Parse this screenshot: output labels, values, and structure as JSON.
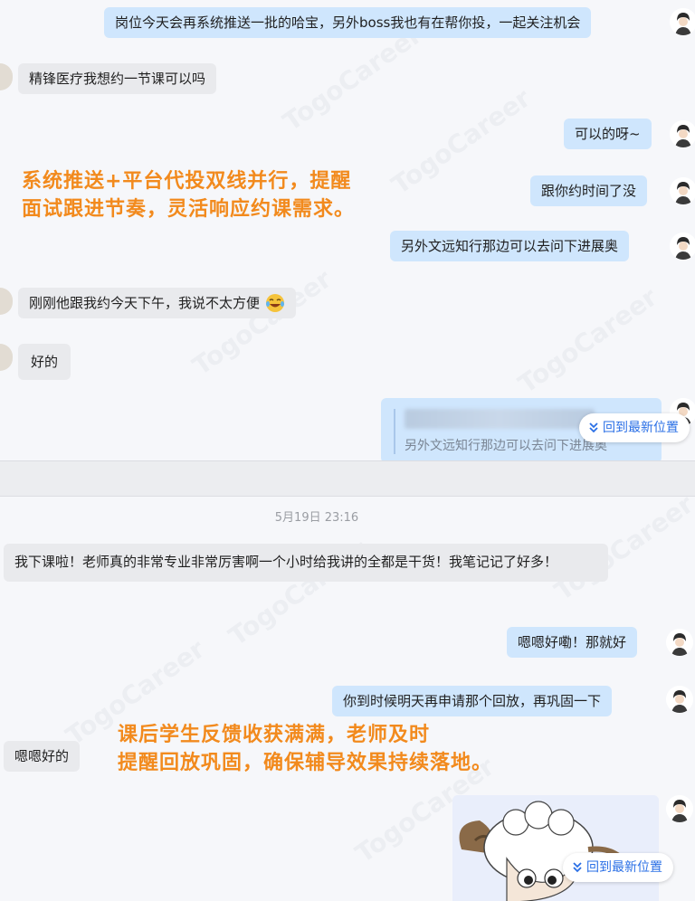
{
  "top_chat": {
    "messages": [
      {
        "side": "out",
        "text": "岗位今天会再系统推送一批的哈宝，另外boss我也有在帮你投，一起关注机会"
      },
      {
        "side": "in",
        "text": "精锋医疗我想约一节课可以吗"
      },
      {
        "side": "out",
        "text": "可以的呀~"
      },
      {
        "side": "out",
        "text": "跟你约时间了没"
      },
      {
        "side": "out",
        "text": "另外文远知行那边可以去问下进展奥"
      },
      {
        "side": "in",
        "text": "刚刚他跟我约今天下午，我说不太方便"
      },
      {
        "side": "in",
        "text": "好的"
      }
    ],
    "quoted_text": "另外文远知行那边可以去问下进展奥",
    "jump_button_label": "回到最新位置",
    "overlay_caption": [
      "系统推送+平台代投双线并行，提醒",
      "面试跟进节奏，灵活响应约课需求。"
    ]
  },
  "bottom_chat": {
    "timestamp": "5月19日 23:16",
    "messages": [
      {
        "side": "in",
        "text": "我下课啦！老师真的非常专业非常厉害啊一个小时给我讲的全都是干货！我笔记记了好多！"
      },
      {
        "side": "out",
        "text": "嗯嗯好嘞！那就好"
      },
      {
        "side": "out",
        "text": "你到时候明天再申请那个回放，再巩固一下"
      },
      {
        "side": "in",
        "text": "嗯嗯好的"
      }
    ],
    "jump_button_label": "回到最新位置",
    "overlay_caption": [
      "课后学生反馈收获满满，老师及时",
      "提醒回放巩固，确保辅导效果持续落地。"
    ]
  },
  "watermark_text": "TogoCareer",
  "colors": {
    "outgoing_bubble": "#cfe6fd",
    "incoming_bubble": "#e9eaed",
    "caption_orange": "#f28a1d",
    "link_blue": "#2a6fe6"
  },
  "icons": {
    "jump_icon": "chevrons-down-icon",
    "emoji": "laughing-tears-emoji"
  }
}
